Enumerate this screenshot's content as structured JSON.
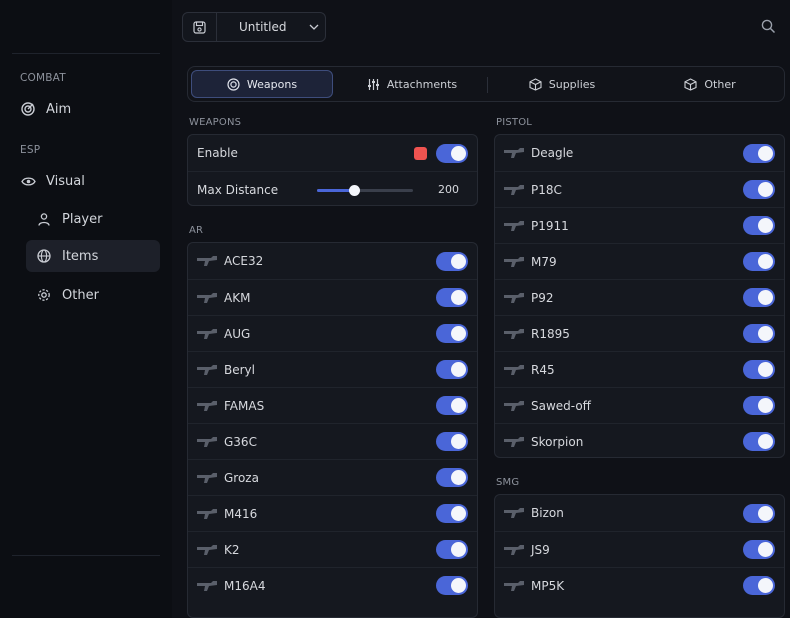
{
  "sidebar": {
    "sections": [
      {
        "label": "COMBAT"
      },
      {
        "label": "ESP"
      }
    ],
    "items": {
      "aim": "Aim",
      "visual": "Visual",
      "player": "Player",
      "items": "Items",
      "other": "Other"
    }
  },
  "topbar": {
    "config_name": "Untitled"
  },
  "tabs": [
    "Weapons",
    "Attachments",
    "Supplies",
    "Other"
  ],
  "weapons_section": {
    "label": "WEAPONS",
    "enable_label": "Enable",
    "enable_color": "#ef5350",
    "enable_on": true,
    "max_distance_label": "Max Distance",
    "max_distance_value": "200",
    "max_distance_fraction": 0.39
  },
  "ar": {
    "label": "AR",
    "items": [
      "ACE32",
      "AKM",
      "AUG",
      "Beryl",
      "FAMAS",
      "G36C",
      "Groza",
      "M416",
      "K2",
      "M16A4"
    ]
  },
  "pistol": {
    "label": "PISTOL",
    "items": [
      "Deagle",
      "P18C",
      "P1911",
      "M79",
      "P92",
      "R1895",
      "R45",
      "Sawed-off",
      "Skorpion"
    ]
  },
  "smg": {
    "label": "SMG",
    "items": [
      "Bizon",
      "JS9",
      "MP5K"
    ]
  },
  "colors": {
    "accent": "#4a66d8",
    "swatch": "#ef5350"
  }
}
